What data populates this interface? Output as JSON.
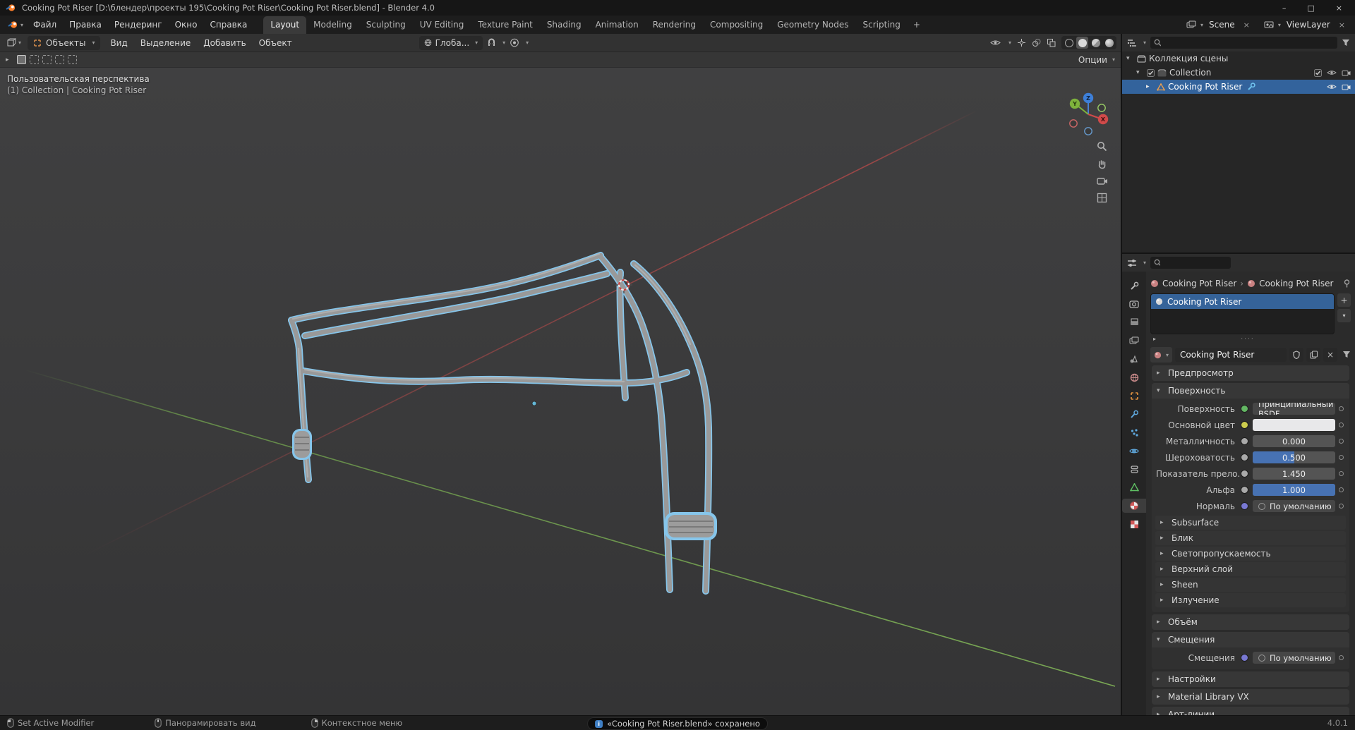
{
  "window": {
    "title": "Cooking Pot Riser [D:\\блендер\\проекты 195\\Cooking Pot Riser\\Cooking Pot Riser.blend] - Blender 4.0",
    "controls": {
      "minimize": "–",
      "maximize": "□",
      "close": "×"
    }
  },
  "topbar": {
    "menus": [
      "Файл",
      "Правка",
      "Рендеринг",
      "Окно",
      "Справка"
    ],
    "workspaces": [
      "Layout",
      "Modeling",
      "Sculpting",
      "UV Editing",
      "Texture Paint",
      "Shading",
      "Animation",
      "Rendering",
      "Compositing",
      "Geometry Nodes",
      "Scripting"
    ],
    "add_tab": "+",
    "scene_name": "Scene",
    "view_layer_name": "ViewLayer"
  },
  "viewport": {
    "mode": "Объекты",
    "menus": [
      "Вид",
      "Выделение",
      "Добавить",
      "Объект"
    ],
    "orientation": "Глоба...",
    "options_label": "Опции",
    "overlay_line1": "Пользовательская перспектива",
    "overlay_line2": "(1) Collection | Cooking Pot Riser",
    "gizmo_axes": {
      "x": "X",
      "y": "Y",
      "z": "Z"
    },
    "colors": {
      "axis_x": "#a64848",
      "axis_y": "#6f9d4d",
      "selection_outline": "#86c5ea",
      "tube": "#999999",
      "accent": "#4772b3"
    }
  },
  "outliner": {
    "rows": [
      {
        "label": "Коллекция сцены"
      },
      {
        "label": "Collection"
      },
      {
        "label": "Cooking Pot Riser"
      }
    ]
  },
  "properties": {
    "breadcrumb_object": "Cooking Pot Riser",
    "breadcrumb_separator": "›",
    "breadcrumb_material": "Cooking Pot Riser",
    "slot_name": "Cooking Pot Riser",
    "material_name": "Cooking Pot Riser",
    "add_slot_label": "+",
    "slot_menu_label": "▾",
    "preview_panel": "Предпросмотр",
    "surface_panel": "Поверхность",
    "surface_rows": [
      {
        "label": "Поверхность",
        "value": "Принципиальный BSDF",
        "socket_style": "background:#63b763"
      },
      {
        "label": "Основной цвет",
        "value": "",
        "socket_style": "background:#cdcd4e"
      },
      {
        "label": "Металличность",
        "value": "0.000",
        "socket_style": "background:#a9a9a9",
        "fill_style": "width:0%"
      },
      {
        "label": "Шероховатость",
        "value": "0.500",
        "socket_style": "background:#a9a9a9",
        "fill_style": "width:50%"
      },
      {
        "label": "Показатель прело...",
        "value": "1.450",
        "socket_style": "background:#a9a9a9"
      },
      {
        "label": "Альфа",
        "value": "1.000",
        "socket_style": "background:#a9a9a9",
        "fill_style": "width:100%"
      },
      {
        "label": "Нормаль",
        "value": "По умолчанию",
        "socket_style": "background:#7878d2"
      }
    ],
    "sub_panels": [
      "Subsurface",
      "Блик",
      "Светопропускаемость",
      "Верхний слой",
      "Sheen",
      "Излучение"
    ],
    "volume_panel": "Объём",
    "displacement": {
      "panel": "Смещения",
      "label": "Смещения",
      "value": "По умолчанию",
      "socket_style": "background:#7878d2"
    },
    "bottom_panels": [
      "Настройки",
      "Material Library VX",
      "Арт-линии"
    ]
  },
  "statusbar": {
    "left": "Set Active Modifier",
    "pan": "Панорамировать вид",
    "context_menu": "Контекстное меню",
    "notification": "«Cooking Pot Riser.blend» сохранено",
    "version": "4.0.1"
  }
}
